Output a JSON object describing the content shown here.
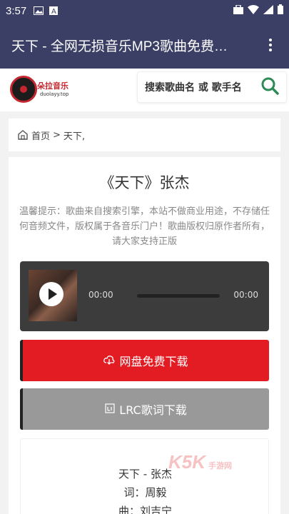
{
  "status": {
    "time": "3:57"
  },
  "appbar": {
    "title": "天下 - 全网无损音乐MP3歌曲免费…"
  },
  "header": {
    "logo_name": "朵拉音乐",
    "logo_url": "duolayy.top",
    "search_placeholder": "搜索歌曲名 或 歌手名"
  },
  "breadcrumb": {
    "home": "首页",
    "sep": ">",
    "current": "天下,"
  },
  "song": {
    "title": "《天下》张杰",
    "tip": "温馨提示：歌曲来自搜索引擎，本站不做商业用途，不存储任何音频文件，版权属于各音乐门户！歌曲版权归原作者所有，请大家支持正版"
  },
  "player": {
    "current_time": "00:00",
    "duration": "00:00",
    "progress": 0
  },
  "buttons": {
    "download": "网盘免费下载",
    "lrc": "LRC歌词下载"
  },
  "lyrics": {
    "lines": [
      "天下 - 张杰",
      "词：周毅",
      "曲：刘吉宁"
    ]
  },
  "watermark": {
    "text": "K5K",
    "sub": "手游网"
  },
  "colors": {
    "bar": "#3b3f66",
    "accent": "#e31b23",
    "search_icon": "#2e8b57"
  }
}
